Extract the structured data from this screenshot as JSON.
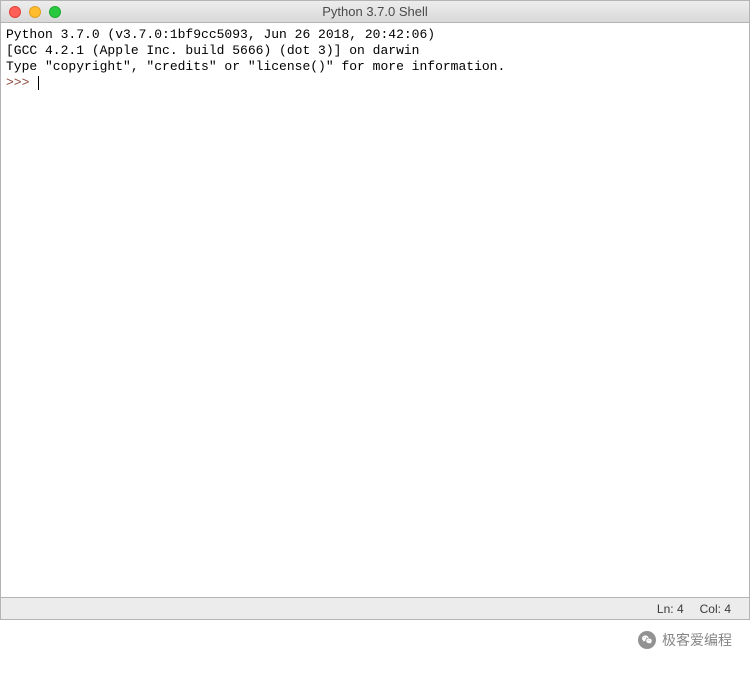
{
  "window": {
    "title": "Python 3.7.0 Shell"
  },
  "shell": {
    "line1": "Python 3.7.0 (v3.7.0:1bf9cc5093, Jun 26 2018, 20:42:06)",
    "line2": "[GCC 4.2.1 (Apple Inc. build 5666) (dot 3)] on darwin",
    "line3": "Type \"copyright\", \"credits\" or \"license()\" for more information.",
    "prompt": ">>> "
  },
  "status": {
    "ln_label": "Ln:",
    "ln_value": "4",
    "col_label": "Col:",
    "col_value": "4"
  },
  "watermark": {
    "text": "极客爱编程"
  }
}
